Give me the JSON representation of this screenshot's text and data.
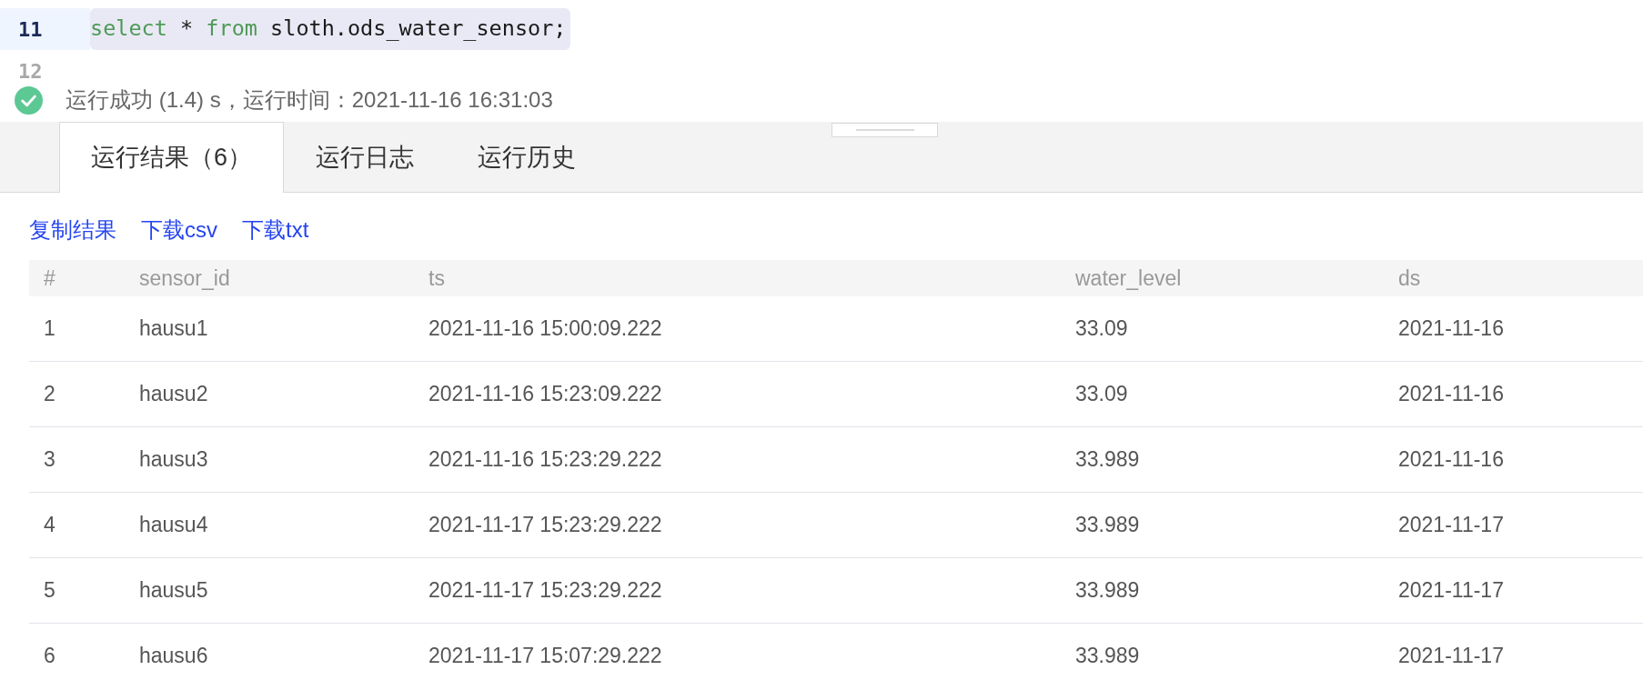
{
  "editor": {
    "lines": [
      {
        "number": "11",
        "selected": true,
        "tokens": [
          {
            "kind": "keyword",
            "text": "select"
          },
          {
            "kind": "plain",
            "text": " * "
          },
          {
            "kind": "keyword",
            "text": "from"
          },
          {
            "kind": "plain",
            "text": " sloth.ods_water_sensor;"
          }
        ]
      },
      {
        "number": "12",
        "selected": false
      }
    ]
  },
  "status": {
    "kind": "success",
    "text": "运行成功 (1.4) s，运行时间：2021-11-16 16:31:03"
  },
  "tabs": [
    {
      "label": "运行结果（6）",
      "selected": true
    },
    {
      "label": "运行日志",
      "selected": false
    },
    {
      "label": "运行历史",
      "selected": false
    }
  ],
  "actions": [
    "复制结果",
    "下载csv",
    "下载txt"
  ],
  "table": {
    "columns": [
      "#",
      "sensor_id",
      "ts",
      "water_level",
      "ds"
    ],
    "rows": [
      [
        "1",
        "hausu1",
        "2021-11-16 15:00:09.222",
        "33.09",
        "2021-11-16"
      ],
      [
        "2",
        "hausu2",
        "2021-11-16 15:23:09.222",
        "33.09",
        "2021-11-16"
      ],
      [
        "3",
        "hausu3",
        "2021-11-16 15:23:29.222",
        "33.989",
        "2021-11-16"
      ],
      [
        "4",
        "hausu4",
        "2021-11-17 15:23:29.222",
        "33.989",
        "2021-11-17"
      ],
      [
        "5",
        "hausu5",
        "2021-11-17 15:23:29.222",
        "33.989",
        "2021-11-17"
      ],
      [
        "6",
        "hausu6",
        "2021-11-17 15:07:29.222",
        "33.989",
        "2021-11-17"
      ]
    ]
  }
}
